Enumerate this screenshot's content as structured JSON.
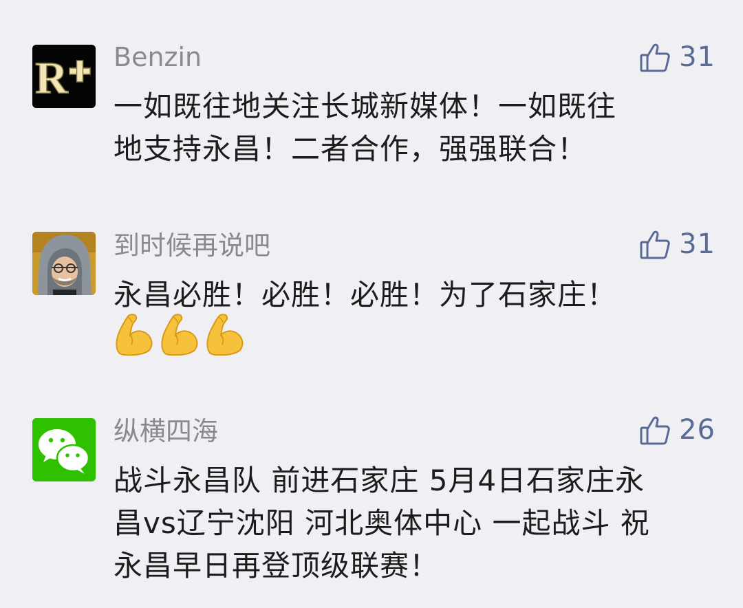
{
  "comments": [
    {
      "author": "Benzin",
      "avatar_icon": "rplus-logo-icon",
      "likes": "31",
      "lines": [
        "一如既往地关注长城新媒体！一如既往",
        "地支持永昌！二者合作，强强联合！"
      ]
    },
    {
      "author": "到时候再说吧",
      "avatar_icon": "hooded-man-photo",
      "likes": "31",
      "lines": [
        "永昌必胜！必胜！必胜！为了石家庄！"
      ],
      "emoji": [
        "flexed-biceps-icon",
        "flexed-biceps-icon",
        "flexed-biceps-icon"
      ]
    },
    {
      "author": "纵横四海",
      "avatar_icon": "wechat-logo-icon",
      "likes": "26",
      "lines": [
        "战斗永昌队 前进石家庄 5月4日石家庄永",
        "昌vs辽宁沈阳 河北奥体中心 一起战斗 祝",
        "永昌早日再登顶级联赛！"
      ]
    }
  ],
  "colors": {
    "background": "#efeff4",
    "author": "#8a8a8e",
    "like_accent": "#576b95",
    "wechat_green": "#2dc100"
  }
}
